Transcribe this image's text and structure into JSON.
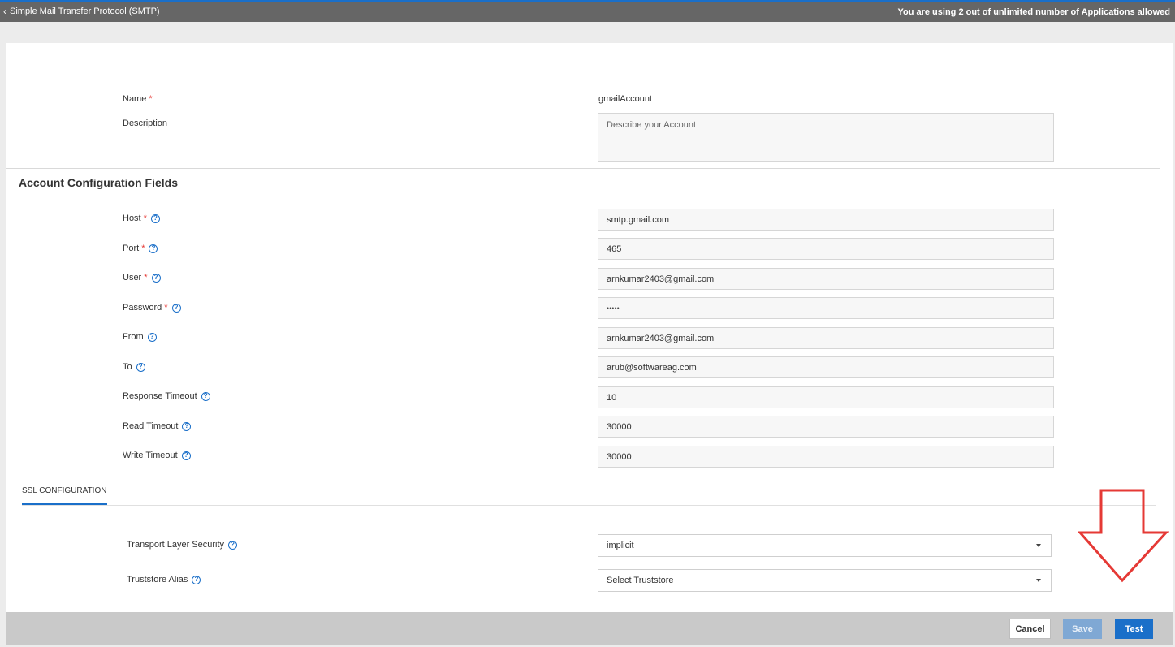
{
  "header": {
    "back_label": "Simple Mail Transfer Protocol (SMTP)",
    "usage_text": "You are using 2 out of unlimited number of Applications allowed"
  },
  "general": {
    "name_label": "Name",
    "name_value": "gmailAccount",
    "description_label": "Description",
    "description_placeholder": "Describe your Account"
  },
  "section_title": "Account Configuration Fields",
  "fields": {
    "host": {
      "label": "Host",
      "value": "smtp.gmail.com",
      "required": true
    },
    "port": {
      "label": "Port",
      "value": "465",
      "required": true
    },
    "user": {
      "label": "User",
      "value": "arnkumar2403@gmail.com",
      "required": true
    },
    "password": {
      "label": "Password",
      "value": "•••••",
      "required": true
    },
    "from": {
      "label": "From",
      "value": "arnkumar2403@gmail.com",
      "required": false
    },
    "to": {
      "label": "To",
      "value": "arub@softwareag.com",
      "required": false
    },
    "response_timeout": {
      "label": "Response Timeout",
      "value": "10",
      "required": false
    },
    "read_timeout": {
      "label": "Read Timeout",
      "value": "30000",
      "required": false
    },
    "write_timeout": {
      "label": "Write Timeout",
      "value": "30000",
      "required": false
    }
  },
  "required_mark": "*",
  "help_glyph": "?",
  "ssl": {
    "tab_label": "SSL CONFIGURATION",
    "tls_label": "Transport Layer Security",
    "tls_value": "implicit",
    "truststore_label": "Truststore Alias",
    "truststore_value": "Select Truststore"
  },
  "footer": {
    "cancel_label": "Cancel",
    "save_label": "Save",
    "test_label": "Test"
  },
  "colors": {
    "accent": "#1a6fc9",
    "header_bg": "#666666",
    "required": "#e53935",
    "annotation_arrow": "#e53935"
  },
  "icons": {
    "back": "chevron-left-icon",
    "help": "help-circle-icon",
    "dropdown": "caret-down-icon",
    "annotation": "down-arrow-annotation"
  }
}
